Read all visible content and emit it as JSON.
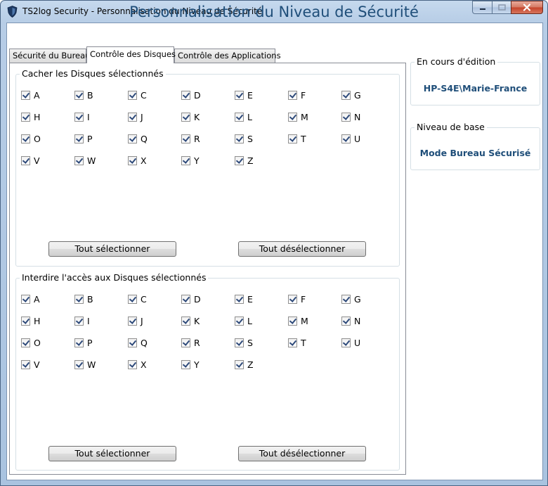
{
  "window": {
    "title": "TS2log Security - Personnalisation du Niveau de Sécurité"
  },
  "heading": "Personnalisation du Niveau de Sécurité",
  "tabs": [
    {
      "label": "Sécurité du Bureau"
    },
    {
      "label": "Contrôle des Disques"
    },
    {
      "label": "Contrôle des Applications"
    }
  ],
  "hide_group": {
    "label": "Cacher les Disques sélectionnés",
    "select_all": "Tout sélectionner",
    "deselect_all": "Tout désélectionner"
  },
  "deny_group": {
    "label": "Interdire l'accès aux Disques sélectionnés",
    "select_all": "Tout sélectionner",
    "deselect_all": "Tout désélectionner"
  },
  "drives": [
    "A",
    "B",
    "C",
    "D",
    "E",
    "F",
    "G",
    "H",
    "I",
    "J",
    "K",
    "L",
    "M",
    "N",
    "O",
    "P",
    "Q",
    "R",
    "S",
    "T",
    "U",
    "V",
    "W",
    "X",
    "Y",
    "Z"
  ],
  "hide_checked": true,
  "deny_checked": true,
  "editing": {
    "label": "En cours d'édition",
    "value": "HP-S4E\\Marie-France"
  },
  "base_level": {
    "label": "Niveau de base",
    "value": "Mode Bureau Sécurisé"
  },
  "icons": {
    "app": "shield-icon",
    "minimize": "minimize-icon",
    "maximize": "maximize-icon",
    "close": "close-icon",
    "checkbox": "checkmark-icon"
  }
}
